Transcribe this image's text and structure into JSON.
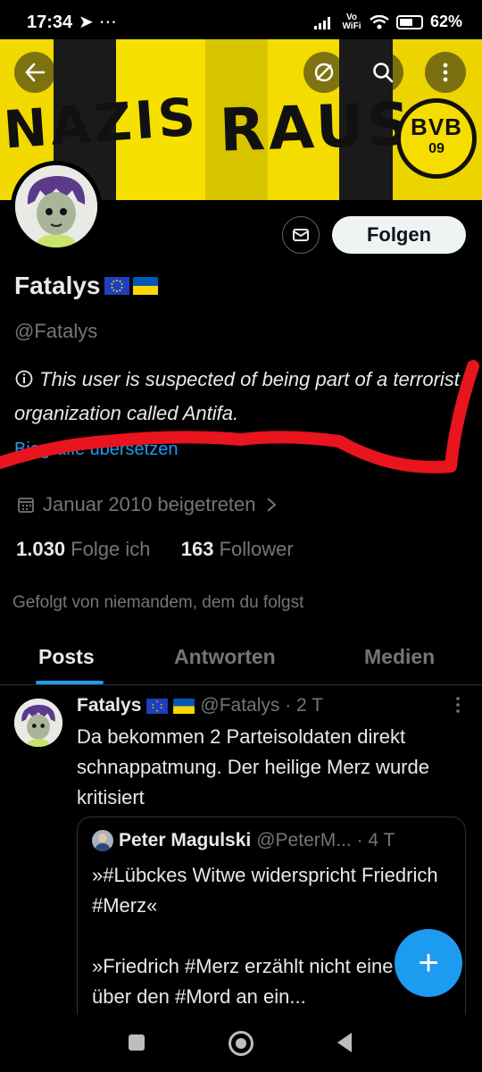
{
  "status_bar": {
    "time": "17:34",
    "left_icons": [
      "telegram-icon",
      "more-dots-icon"
    ],
    "right_icons": [
      "signal-icon",
      "vowifi-icon",
      "wifi-icon"
    ],
    "vowifi": "Vo WiFi",
    "battery": "62%",
    "battery_level": 0.62
  },
  "banner": {
    "word1": "NAZIS",
    "word2": "RAUS",
    "logo_top": "BVB",
    "logo_bottom": "09",
    "colors": {
      "yellow": "#f0d800",
      "black": "#111111"
    }
  },
  "top_actions": [
    "back-arrow-icon",
    "grok-icon",
    "search-icon",
    "more-vertical-icon"
  ],
  "profile": {
    "name": "Fatalys",
    "handle": "@Fatalys",
    "bio_icon": "info-icon",
    "bio": "This user is suspected of being part of a terrorist organization called Antifa.",
    "bio_more": "Biografie übersetzen",
    "joined": "Januar 2010 beigetreten",
    "following_count": "1.030",
    "following_label": "Folge ich",
    "followers_count": "163",
    "followers_label": "Follower",
    "followed_by": "Gefolgt von niemandem, dem du folgst"
  },
  "buttons": {
    "follow": "Folgen",
    "message_icon": "mail-icon"
  },
  "tabs": [
    "Posts",
    "Antworten",
    "Medien"
  ],
  "active_tab": 0,
  "post": {
    "author": "Fatalys",
    "meta": "@Fatalys · 2 T",
    "text": "Da bekommen 2 Parteisoldaten direkt schnappatmung. Der heilige Merz wurde kritisiert",
    "quote": {
      "author": "Peter Magulski",
      "meta": "@PeterM... · 4 T",
      "text": "»#Lübckes Witwe widerspricht Friedrich #Merz«\n\n»Friedrich #Merz erzählt nicht eine Lüge über den #Mord an ein..."
    }
  },
  "fab_label": "+",
  "colors": {
    "accent": "#1d9bf0",
    "background": "#000000",
    "muted": "#71767b",
    "annotation_red": "#e8141e",
    "eu_blue": "#1f3fbf",
    "eu_star": "#ffd500",
    "ukraine_blue": "#0057b7",
    "ukraine_yellow": "#ffd700"
  }
}
